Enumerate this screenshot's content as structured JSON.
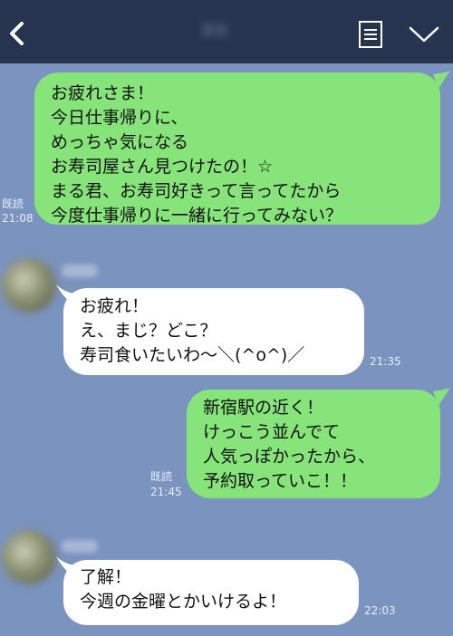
{
  "header": {
    "title": "まる",
    "back_icon": "chevron-left-icon",
    "menu_icon": "list-icon",
    "collapse_icon": "chevron-down-icon"
  },
  "colors": {
    "background": "#7b93bf",
    "header": "#263450",
    "sent_bubble": "#87e47b",
    "received_bubble": "#ffffff"
  },
  "messages": [
    {
      "direction": "sent",
      "text": "お疲れさま！\n今日仕事帰りに、\nめっちゃ気になる\nお寿司屋さん見つけたの！☆\nまる君、お寿司好きって言ってたから\n今度仕事帰りに一緒に行ってみない？",
      "read": "既読",
      "time": "21:08"
    },
    {
      "direction": "received",
      "text": "お疲れ！\nえ、まじ？どこ？\n寿司食いたいわ〜＼(^o^)／",
      "time": "21:35"
    },
    {
      "direction": "sent",
      "text": "新宿駅の近く！\nけっこう並んでて\n人気っぽかったから、\n予約取っていこ！！",
      "read": "既読",
      "time": "21:45"
    },
    {
      "direction": "received",
      "text": "了解！\n今週の金曜とかいけるよ！",
      "time": "22:03"
    }
  ]
}
